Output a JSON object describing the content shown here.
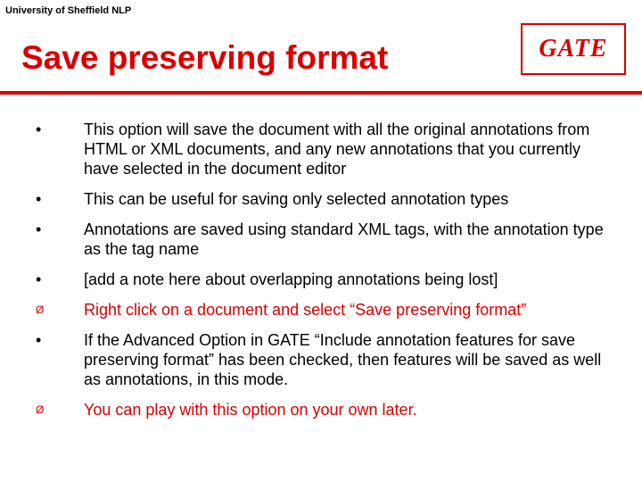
{
  "header": {
    "org_label": "University of Sheffield NLP"
  },
  "logo": {
    "text": "GATE"
  },
  "title": "Save preserving format",
  "bullets": [
    {
      "mark": "•",
      "red": false,
      "text": "This option will save the document with all the original annotations from HTML or XML documents, and any new annotations that you currently have selected in the document editor"
    },
    {
      "mark": "•",
      "red": false,
      "text": "This can be useful for saving only selected annotation types"
    },
    {
      "mark": "•",
      "red": false,
      "text": "Annotations are saved using standard XML tags, with the annotation type as the tag name"
    },
    {
      "mark": "•",
      "red": false,
      "text": "[add a note here about overlapping annotations being lost]"
    },
    {
      "mark": "Ø",
      "red": true,
      "text": "Right click on a document and select “Save preserving format”"
    },
    {
      "mark": "•",
      "red": false,
      "text": "If the Advanced Option in GATE  “Include annotation features for save preserving format” has been checked, then features will be saved as well as annotations, in this mode."
    },
    {
      "mark": "Ø",
      "red": true,
      "text": "You can play with this option on your own later."
    }
  ]
}
